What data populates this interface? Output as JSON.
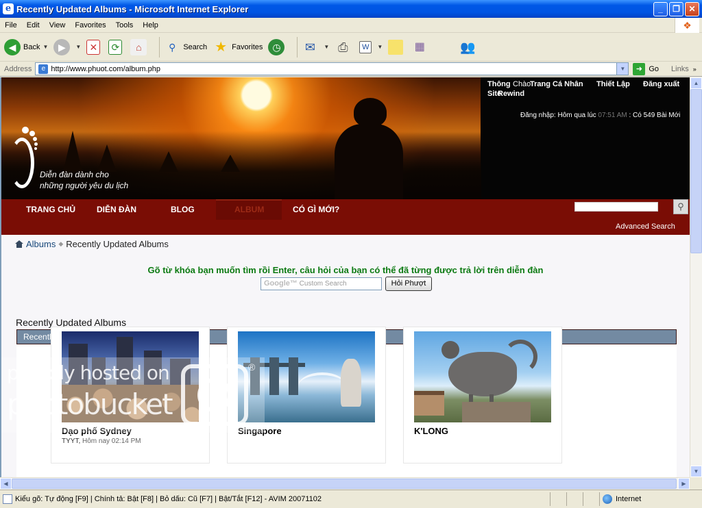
{
  "window": {
    "title": "Recently Updated Albums - Microsoft Internet Explorer"
  },
  "menu": [
    "File",
    "Edit",
    "View",
    "Favorites",
    "Tools",
    "Help"
  ],
  "toolbar": {
    "back_label": "Back",
    "search_label": "Search",
    "favorites_label": "Favorites"
  },
  "address": {
    "label": "Address",
    "url": "http://www.phuot.com/album.php",
    "go_label": "Go",
    "links_label": "Links"
  },
  "banner": {
    "slogan_line1": "Diễn đàn dành cho",
    "slogan_line2": "những người yêu du lịch",
    "top_links": {
      "thong": "Thông",
      "chao": "Chào",
      "trang_ca_nhan": "Trang Cá Nhân",
      "thiet_lap": "Thiết Lập",
      "dang_xuat": "Đăng xuất",
      "site": "Site",
      "rewind": "Rewind"
    },
    "login_prefix": "Đăng nhập: Hôm qua lúc",
    "login_time": "07:51 AM",
    "login_suffix": ": Có 549 Bài Mới"
  },
  "nav": {
    "items": [
      "TRANG CHỦ",
      "DIỄN ĐÀN",
      "BLOG",
      "ALBUM",
      "CÓ GÌ MỚI?"
    ],
    "advanced_search": "Advanced Search"
  },
  "breadcrumb": {
    "root": "Albums",
    "current": "Recently Updated Albums"
  },
  "search_prompt": "Gõ từ khóa bạn muốn tìm rồi Enter, câu hỏi của bạn có thể đã từng được trả lời trên diễn đàn",
  "google_search": {
    "brand": "Google™",
    "placeholder": "Custom Search",
    "button": "Hỏi Phượt"
  },
  "section": {
    "title": "Recently Updated Albums",
    "bar_label": "Recently Updated Albums"
  },
  "albums": [
    {
      "title": "Dạo phố Sydney",
      "owner": "TYYT",
      "updated": "Hôm nay 02:14 PM"
    },
    {
      "title": "Singapore"
    },
    {
      "title": "K'LONG"
    }
  ],
  "watermark": {
    "line1": "proudly hosted on",
    "line2": "photobucket"
  },
  "statusbar": {
    "message": "Kiểu gõ: Tự động [F9] | Chính tả: Bật [F8] | Bỏ dấu: Cũ [F7] | Bật/Tắt [F12] - AVIM 20071102",
    "zone": "Internet"
  },
  "colors": {
    "nav_background": "#7a0d05",
    "section_bar": "#738aa2",
    "prompt_green": "#0c7a12",
    "titlebar_blue": "#0054e3"
  }
}
